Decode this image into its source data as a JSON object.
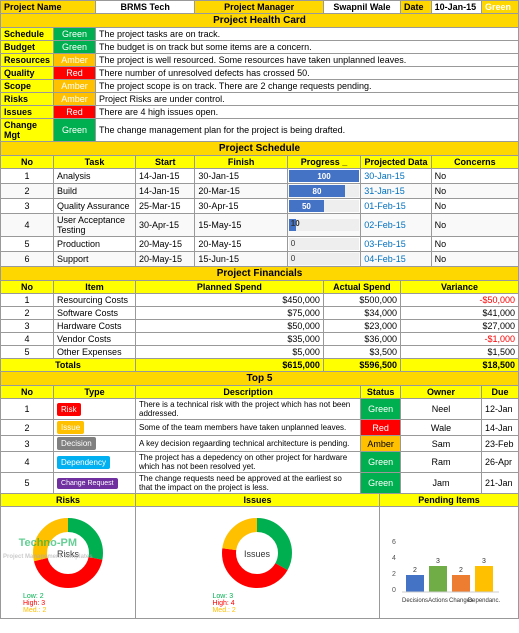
{
  "header": {
    "project_name_label": "Project Name",
    "project_name_value": "BRMS Tech",
    "project_manager_label": "Project Manager",
    "project_manager_value": "Swapnil Wale",
    "date_label": "Date",
    "date_value": "10-Jan-15",
    "status_value": "Green"
  },
  "health_card": {
    "title": "Project Health Card",
    "rows": [
      {
        "name": "Schedule",
        "status": "Green",
        "status_class": "green",
        "description": "The project tasks are on track."
      },
      {
        "name": "Budget",
        "status": "Green",
        "status_class": "green",
        "description": "The budget is on track but some items are a concern."
      },
      {
        "name": "Resources",
        "status": "Amber",
        "status_class": "amber",
        "description": "The project is well resourced. Some resources have taken unplanned leaves."
      },
      {
        "name": "Quality",
        "status": "Red",
        "status_class": "red",
        "description": "There number of unresolved defects has crossed 50."
      },
      {
        "name": "Scope",
        "status": "Amber",
        "status_class": "amber",
        "description": "The project scope is on track. There are 2 change requests pending."
      },
      {
        "name": "Risks",
        "status": "Amber",
        "status_class": "amber",
        "description": "Project Risks are under control."
      },
      {
        "name": "Issues",
        "status": "Red",
        "status_class": "red",
        "description": "There are 4 high issues open."
      },
      {
        "name": "Change Mgt",
        "status": "Green",
        "status_class": "green",
        "description": "The change management plan for the project is being drafted."
      }
    ]
  },
  "schedule": {
    "title": "Project Schedule",
    "columns": [
      "No",
      "Task",
      "Start",
      "Finish",
      "Progress _",
      "Projected Date",
      "Concerns"
    ],
    "rows": [
      {
        "no": "1",
        "task": "Analysis",
        "start": "14-Jan-15",
        "finish": "30-Jan-15",
        "progress": 100,
        "projected_date": "30-Jan-15",
        "concerns": "No"
      },
      {
        "no": "2",
        "task": "Build",
        "start": "14-Jan-15",
        "finish": "20-Mar-15",
        "progress": 80,
        "projected_date": "31-Jan-15",
        "concerns": "No"
      },
      {
        "no": "3",
        "task": "Quality Assurance",
        "start": "25-Mar-15",
        "finish": "30-Apr-15",
        "progress": 50,
        "projected_date": "01-Feb-15",
        "concerns": "No"
      },
      {
        "no": "4",
        "task": "User Acceptance Testing",
        "start": "30-Apr-15",
        "finish": "15-May-15",
        "progress": 10,
        "projected_date": "02-Feb-15",
        "concerns": "No"
      },
      {
        "no": "5",
        "task": "Production",
        "start": "20-May-15",
        "finish": "20-May-15",
        "progress": 0,
        "projected_date": "03-Feb-15",
        "concerns": "No"
      },
      {
        "no": "6",
        "task": "Support",
        "start": "20-May-15",
        "finish": "15-Jun-15",
        "progress": 0,
        "projected_date": "04-Feb-15",
        "concerns": "No"
      }
    ]
  },
  "financials": {
    "title": "Project Financials",
    "columns": [
      "No",
      "Item",
      "Planned Spend",
      "Actual Spend",
      "Variance"
    ],
    "rows": [
      {
        "no": "1",
        "item": "Resourcing Costs",
        "planned": "$450,000",
        "actual": "$500,000",
        "variance": "-$50,000",
        "neg": true
      },
      {
        "no": "2",
        "item": "Software Costs",
        "planned": "$75,000",
        "actual": "$34,000",
        "variance": "$41,000",
        "neg": false
      },
      {
        "no": "3",
        "item": "Hardware Costs",
        "planned": "$50,000",
        "actual": "$23,000",
        "variance": "$27,000",
        "neg": false
      },
      {
        "no": "4",
        "item": "Vendor Costs",
        "planned": "$35,000",
        "actual": "$36,000",
        "variance": "-$1,000",
        "neg": true
      },
      {
        "no": "5",
        "item": "Other Expenses",
        "planned": "$5,000",
        "actual": "$3,500",
        "variance": "$1,500",
        "neg": false
      }
    ],
    "totals": {
      "label": "Totals",
      "planned": "$615,000",
      "actual": "$596,500",
      "variance": "$18,500"
    }
  },
  "top5": {
    "title": "Top 5",
    "columns": [
      "No",
      "Type",
      "Description",
      "Status",
      "Owner",
      "Due"
    ],
    "rows": [
      {
        "no": "1",
        "type": "Risk",
        "type_class": "risk-badge",
        "description": "There is a technical risk with the project which has not been addressed.",
        "status": "Green",
        "status_class": "status-green",
        "owner": "Neel",
        "due": "12-Jan"
      },
      {
        "no": "2",
        "type": "Issue",
        "type_class": "issue-badge",
        "description": "Some of the team members have taken unplanned leaves.",
        "status": "Red",
        "status_class": "status-red",
        "owner": "Wale",
        "due": "14-Jan"
      },
      {
        "no": "3",
        "type": "Decision",
        "type_class": "decision-badge",
        "description": "A key decision regaarding technical architecture is pending.",
        "status": "Amber",
        "status_class": "status-amber",
        "owner": "Sam",
        "due": "23-Feb"
      },
      {
        "no": "4",
        "type": "Dependency",
        "type_class": "dependency-badge",
        "description": "The project has a depedency on other project for hardware which has not been resolved yet.",
        "status": "Green",
        "status_class": "status-green",
        "owner": "Ram",
        "due": "26-Apr"
      },
      {
        "no": "5",
        "type": "Change Request",
        "type_class": "change-badge",
        "description": "The change requests need be approved at the earliest so that the impact on the project is less.",
        "status": "Green",
        "status_class": "status-green",
        "owner": "Jam",
        "due": "21-Jan"
      }
    ]
  },
  "bottom": {
    "risks_header": "Risks",
    "issues_header": "Issues",
    "pending_header": "Pending Items",
    "risks_chart": {
      "segments": [
        {
          "label": "Low: 2",
          "color": "#00B050",
          "pct": 28
        },
        {
          "label": "High: 3",
          "color": "#FF0000",
          "pct": 43
        },
        {
          "label": "Med.: 2",
          "color": "#FFC000",
          "pct": 29
        }
      ]
    },
    "issues_chart": {
      "segments": [
        {
          "label": "Low: 3",
          "color": "#00B050",
          "pct": 33
        },
        {
          "label": "High: 4",
          "color": "#FF0000",
          "pct": 44
        },
        {
          "label": "Med.: 2",
          "color": "#FFC000",
          "pct": 23
        }
      ]
    },
    "bar_chart": {
      "bars": [
        {
          "label": "Decisions",
          "value": 2,
          "color": "#4472C4"
        },
        {
          "label": "Actions",
          "value": 3,
          "color": "#70AD47"
        },
        {
          "label": "Changes",
          "value": 2,
          "color": "#ED7D31"
        },
        {
          "label": "Dependanc.",
          "value": 3,
          "color": "#FFC000"
        }
      ],
      "max": 6
    }
  }
}
